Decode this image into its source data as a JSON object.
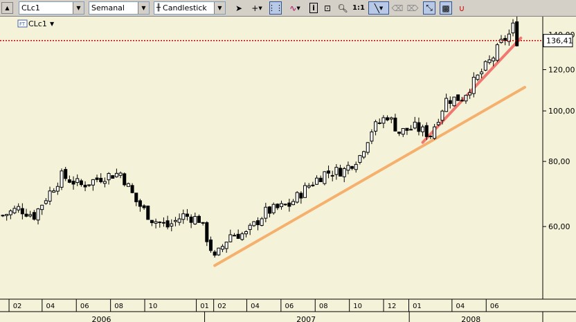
{
  "toolbar": {
    "symbol": "CLc1",
    "period": "Semanal",
    "chart_type": "Candlestick",
    "zoom_label": "1:1"
  },
  "legend": {
    "instrument": "CLc1"
  },
  "price_marker": {
    "value": "136,41",
    "price": 136.41,
    "color": "#c00000"
  },
  "colors": {
    "background": "#f4f2d8",
    "trendline_main": "#f5b06e",
    "trendline_recent": "#f07870"
  },
  "chart_data": {
    "type": "candlestick",
    "title": "",
    "scale": "log",
    "ylim": [
      46,
      148
    ],
    "y_ticks": [
      {
        "value": 60,
        "label": "60,00"
      },
      {
        "value": 80,
        "label": "80,00"
      },
      {
        "value": 100,
        "label": "100,00"
      },
      {
        "value": 120,
        "label": "120,00"
      },
      {
        "value": 140,
        "label": "140,00"
      }
    ],
    "x_month_ticks": [
      "02",
      "04",
      "06",
      "08",
      "10",
      "01",
      "02",
      "04",
      "06",
      "08",
      "10",
      "12",
      "01",
      "04",
      "06"
    ],
    "x_years": [
      "2006",
      "2007",
      "2008"
    ],
    "weekly_close_approx": [
      {
        "date": "2006-01-06",
        "close": 63
      },
      {
        "date": "2006-02-03",
        "close": 65
      },
      {
        "date": "2006-03-03",
        "close": 63
      },
      {
        "date": "2006-04-21",
        "close": 75
      },
      {
        "date": "2006-05-26",
        "close": 72
      },
      {
        "date": "2006-07-07",
        "close": 75
      },
      {
        "date": "2006-08-04",
        "close": 76
      },
      {
        "date": "2006-09-01",
        "close": 67
      },
      {
        "date": "2006-09-29",
        "close": 62
      },
      {
        "date": "2006-10-27",
        "close": 60
      },
      {
        "date": "2006-11-24",
        "close": 63
      },
      {
        "date": "2006-12-22",
        "close": 62
      },
      {
        "date": "2007-01-19",
        "close": 52
      },
      {
        "date": "2007-02-16",
        "close": 58
      },
      {
        "date": "2007-03-16",
        "close": 58
      },
      {
        "date": "2007-04-20",
        "close": 64
      },
      {
        "date": "2007-06-01",
        "close": 66
      },
      {
        "date": "2007-07-06",
        "close": 72
      },
      {
        "date": "2007-08-03",
        "close": 76
      },
      {
        "date": "2007-09-07",
        "close": 77
      },
      {
        "date": "2007-10-05",
        "close": 82
      },
      {
        "date": "2007-10-26",
        "close": 92
      },
      {
        "date": "2007-11-23",
        "close": 98
      },
      {
        "date": "2007-12-14",
        "close": 91
      },
      {
        "date": "2008-01-11",
        "close": 93
      },
      {
        "date": "2008-02-08",
        "close": 90
      },
      {
        "date": "2008-03-07",
        "close": 105
      },
      {
        "date": "2008-04-04",
        "close": 106
      },
      {
        "date": "2008-05-02",
        "close": 116
      },
      {
        "date": "2008-05-30",
        "close": 127
      },
      {
        "date": "2008-06-13",
        "close": 135
      },
      {
        "date": "2008-06-27",
        "close": 140
      },
      {
        "date": "2008-07-04",
        "close": 145
      },
      {
        "date": "2008-07-11",
        "close": 136.41
      }
    ],
    "trendlines": [
      {
        "start": {
          "date": "2007-01-19",
          "price": 50.5
        },
        "end": {
          "date": "2008-07-25",
          "price": 111
        }
      },
      {
        "start": {
          "date": "2008-01-25",
          "price": 87
        },
        "end": {
          "date": "2008-07-18",
          "price": 138
        }
      }
    ]
  }
}
